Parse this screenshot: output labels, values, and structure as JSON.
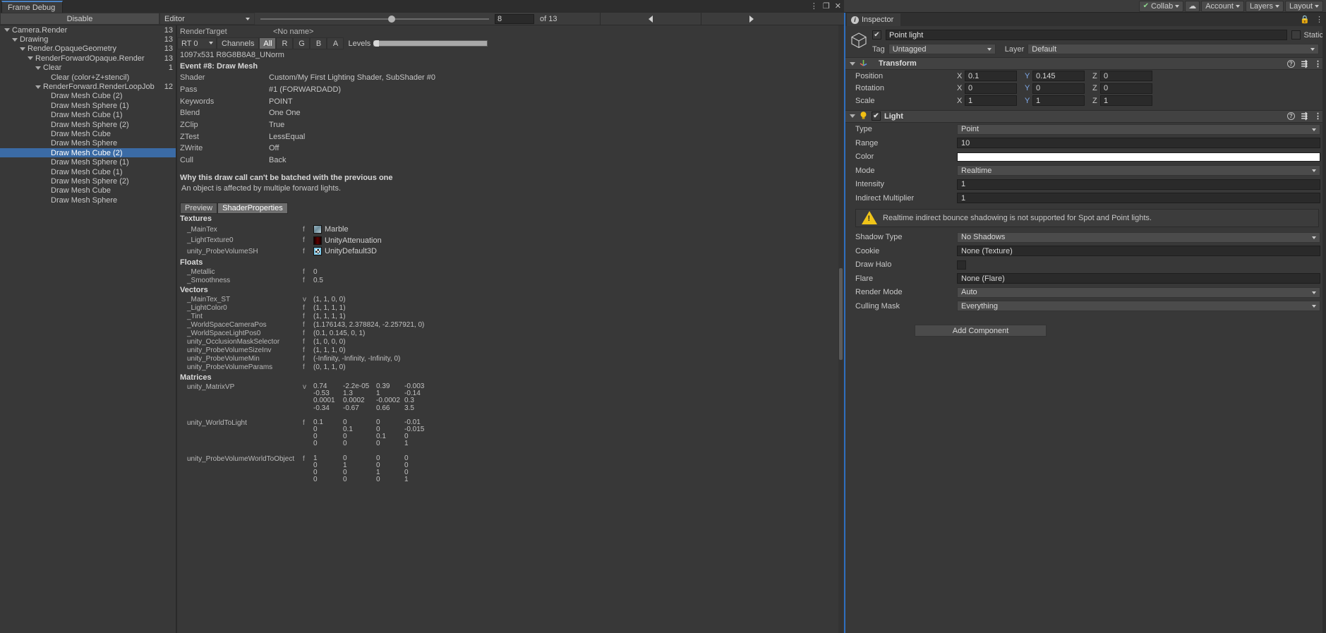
{
  "window": {
    "tab_title": "Frame Debug",
    "kebab_icon": "kebab-menu-icon",
    "maximize_icon": "maximize-icon",
    "close_icon": "close-icon"
  },
  "toolbar": {
    "disable_label": "Disable",
    "editor_label": "Editor",
    "frame_value": "8",
    "frame_total_label": "of 13",
    "prev_icon": "triangle-left-icon",
    "next_icon": "triangle-right-icon"
  },
  "top_bar": {
    "collab_label": "Collab",
    "collab_check_icon": "check-circle-icon",
    "cloud_icon": "cloud-icon",
    "account_label": "Account",
    "layers_label": "Layers",
    "layout_label": "Layout"
  },
  "tree": {
    "nodes": [
      {
        "label": "Camera.Render",
        "count": "13",
        "depth": 0,
        "expanded": true
      },
      {
        "label": "Drawing",
        "count": "13",
        "depth": 1,
        "expanded": true
      },
      {
        "label": "Render.OpaqueGeometry",
        "count": "13",
        "depth": 2,
        "expanded": true
      },
      {
        "label": "RenderForwardOpaque.Render",
        "count": "13",
        "depth": 3,
        "expanded": true
      },
      {
        "label": "Clear",
        "count": "1",
        "depth": 4,
        "expanded": true
      },
      {
        "label": "Clear (color+Z+stencil)",
        "count": "",
        "depth": 5,
        "expanded": false
      },
      {
        "label": "RenderForward.RenderLoopJob",
        "count": "12",
        "depth": 4,
        "expanded": true
      },
      {
        "label": "Draw Mesh Cube (2)",
        "count": "",
        "depth": 5,
        "expanded": false
      },
      {
        "label": "Draw Mesh Sphere (1)",
        "count": "",
        "depth": 5,
        "expanded": false
      },
      {
        "label": "Draw Mesh Cube (1)",
        "count": "",
        "depth": 5,
        "expanded": false
      },
      {
        "label": "Draw Mesh Sphere (2)",
        "count": "",
        "depth": 5,
        "expanded": false
      },
      {
        "label": "Draw Mesh Cube",
        "count": "",
        "depth": 5,
        "expanded": false
      },
      {
        "label": "Draw Mesh Sphere",
        "count": "",
        "depth": 5,
        "expanded": false
      },
      {
        "label": "Draw Mesh Cube (2)",
        "count": "",
        "depth": 5,
        "expanded": false,
        "selected": true
      },
      {
        "label": "Draw Mesh Sphere (1)",
        "count": "",
        "depth": 5,
        "expanded": false
      },
      {
        "label": "Draw Mesh Cube (1)",
        "count": "",
        "depth": 5,
        "expanded": false
      },
      {
        "label": "Draw Mesh Sphere (2)",
        "count": "",
        "depth": 5,
        "expanded": false
      },
      {
        "label": "Draw Mesh Cube",
        "count": "",
        "depth": 5,
        "expanded": false
      },
      {
        "label": "Draw Mesh Sphere",
        "count": "",
        "depth": 5,
        "expanded": false
      }
    ]
  },
  "render_target": {
    "label": "RenderTarget",
    "name": "<No name>",
    "rt_select": "RT 0",
    "channels_label": "Channels",
    "channels": [
      "All",
      "R",
      "G",
      "B",
      "A"
    ],
    "channel_active": "All",
    "levels_label": "Levels",
    "size_format": "1097x531 R8G8B8A8_UNorm"
  },
  "event": {
    "title": "Event #8: Draw Mesh",
    "fields": [
      {
        "key": "Shader",
        "value": "Custom/My First Lighting Shader, SubShader #0"
      },
      {
        "key": "Pass",
        "value": "#1 (FORWARDADD)"
      },
      {
        "key": "Keywords",
        "value": "POINT"
      },
      {
        "key": "Blend",
        "value": "One One"
      },
      {
        "key": "ZClip",
        "value": "True"
      },
      {
        "key": "ZTest",
        "value": "LessEqual"
      },
      {
        "key": "ZWrite",
        "value": "Off"
      },
      {
        "key": "Cull",
        "value": "Back"
      }
    ],
    "batch_title": "Why this draw call can't be batched with the previous one",
    "batch_reason": "An object is affected by multiple forward lights.",
    "tabs": [
      {
        "label": "Preview",
        "active": false
      },
      {
        "label": "ShaderProperties",
        "active": true
      }
    ]
  },
  "shader_properties": {
    "textures_header": "Textures",
    "textures": [
      {
        "name": "_MainTex",
        "type": "f",
        "value": "Marble",
        "thumb": "marble"
      },
      {
        "name": "_LightTexture0",
        "type": "f",
        "value": "UnityAttenuation",
        "thumb": "attenuation"
      },
      {
        "name": "unity_ProbeVolumeSH",
        "type": "f",
        "value": "UnityDefault3D",
        "thumb": "default3d"
      }
    ],
    "floats_header": "Floats",
    "floats": [
      {
        "name": "_Metallic",
        "type": "f",
        "value": "0"
      },
      {
        "name": "_Smoothness",
        "type": "f",
        "value": "0.5"
      }
    ],
    "vectors_header": "Vectors",
    "vectors": [
      {
        "name": "_MainTex_ST",
        "type": "v",
        "value": "(1, 1, 0, 0)"
      },
      {
        "name": "_LightColor0",
        "type": "f",
        "value": "(1, 1, 1, 1)"
      },
      {
        "name": "_Tint",
        "type": "f",
        "value": "(1, 1, 1, 1)"
      },
      {
        "name": "_WorldSpaceCameraPos",
        "type": "f",
        "value": "(1.176143, 2.378824, -2.257921, 0)"
      },
      {
        "name": "_WorldSpaceLightPos0",
        "type": "f",
        "value": "(0.1, 0.145, 0, 1)"
      },
      {
        "name": "unity_OcclusionMaskSelector",
        "type": "f",
        "value": "(1, 0, 0, 0)"
      },
      {
        "name": "unity_ProbeVolumeSizeInv",
        "type": "f",
        "value": "(1, 1, 1, 0)"
      },
      {
        "name": "unity_ProbeVolumeMin",
        "type": "f",
        "value": "(-Infinity, -Infinity, -Infinity, 0)"
      },
      {
        "name": "unity_ProbeVolumeParams",
        "type": "f",
        "value": "(0, 1, 1, 0)"
      }
    ],
    "matrices_header": "Matrices",
    "matrices": [
      {
        "name": "unity_MatrixVP",
        "type": "v",
        "rows": [
          [
            "0.74",
            "-2.2e-05",
            "0.39",
            "-0.003"
          ],
          [
            "-0.53",
            "1.3",
            "1",
            "-0.14"
          ],
          [
            "0.0001",
            "0.0002",
            "-0.0002",
            "0.3"
          ],
          [
            "-0.34",
            "-0.67",
            "0.66",
            "3.5"
          ]
        ]
      },
      {
        "name": "unity_WorldToLight",
        "type": "f",
        "rows": [
          [
            "0.1",
            "0",
            "0",
            "-0.01"
          ],
          [
            "0",
            "0.1",
            "0",
            "-0.015"
          ],
          [
            "0",
            "0",
            "0.1",
            "0"
          ],
          [
            "0",
            "0",
            "0",
            "1"
          ]
        ]
      },
      {
        "name": "unity_ProbeVolumeWorldToObject",
        "type": "f",
        "rows": [
          [
            "1",
            "0",
            "0",
            "0"
          ],
          [
            "0",
            "1",
            "0",
            "0"
          ],
          [
            "0",
            "0",
            "1",
            "0"
          ],
          [
            "0",
            "0",
            "0",
            "1"
          ]
        ]
      }
    ]
  },
  "inspector": {
    "tab_label": "Inspector",
    "info_icon": "info-icon",
    "lock_icon": "lock-icon",
    "menu_icon": "kebab-menu-icon",
    "object": {
      "icon": "game-object-cube-icon",
      "enabled": true,
      "name": "Point light",
      "static_label": "Static",
      "tag_label": "Tag",
      "tag_value": "Untagged",
      "layer_label": "Layer",
      "layer_value": "Default"
    },
    "transform": {
      "title": "Transform",
      "icon": "transform-axis-icon",
      "help_icon": "help-icon",
      "preset_icon": "preset-icon",
      "menu_icon": "kebab-menu-icon",
      "rows": [
        {
          "label": "Position",
          "x": "0.1",
          "y": "0.145",
          "z": "0"
        },
        {
          "label": "Rotation",
          "x": "0",
          "y": "0",
          "z": "0"
        },
        {
          "label": "Scale",
          "x": "1",
          "y": "1",
          "z": "1"
        }
      ]
    },
    "light": {
      "title": "Light",
      "icon": "light-bulb-icon",
      "enabled": true,
      "help_icon": "help-icon",
      "preset_icon": "preset-icon",
      "menu_icon": "kebab-menu-icon",
      "type_label": "Type",
      "type_value": "Point",
      "range_label": "Range",
      "range_value": "10",
      "color_label": "Color",
      "color_value": "#ffffff",
      "mode_label": "Mode",
      "mode_value": "Realtime",
      "intensity_label": "Intensity",
      "intensity_value": "1",
      "indirect_label": "Indirect Multiplier",
      "indirect_value": "1",
      "warning_icon": "warning-triangle-icon",
      "warning_text": "Realtime indirect bounce shadowing is not supported for Spot and Point lights.",
      "shadow_label": "Shadow Type",
      "shadow_value": "No Shadows",
      "cookie_label": "Cookie",
      "cookie_value": "None (Texture)",
      "halo_label": "Draw Halo",
      "flare_label": "Flare",
      "flare_value": "None (Flare)",
      "render_mode_label": "Render Mode",
      "render_mode_value": "Auto",
      "culling_label": "Culling Mask",
      "culling_value": "Everything"
    },
    "add_component_label": "Add Component"
  }
}
